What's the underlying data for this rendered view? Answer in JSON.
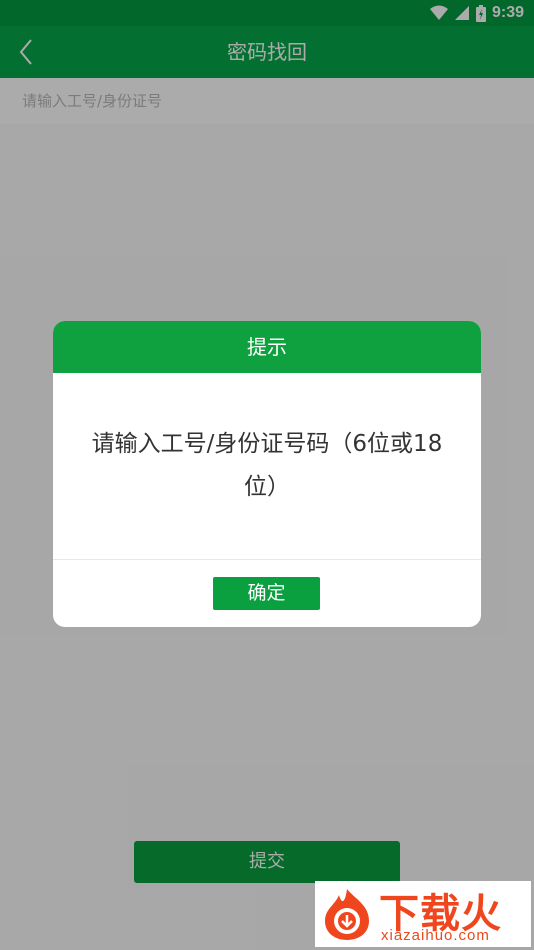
{
  "status_bar": {
    "time": "9:39"
  },
  "app_bar": {
    "title": "密码找回"
  },
  "form": {
    "id_input_placeholder": "请输入工号/身份证号",
    "id_input_value": ""
  },
  "submit_button": {
    "label": "提交"
  },
  "dialog": {
    "title": "提示",
    "message": "请输入工号/身份证号码（6位或18位）",
    "confirm_label": "确定"
  },
  "watermark": {
    "title": "下载火",
    "domain": "xiazaihuo.com"
  },
  "colors": {
    "primary_green": "#05a84a",
    "status_green": "#049a3f",
    "button_green": "#0aa03f",
    "watermark_orange": "#f0461e"
  }
}
